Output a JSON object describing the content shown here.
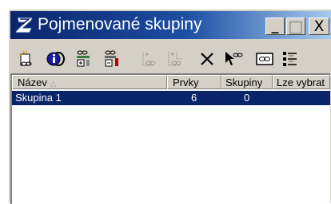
{
  "window": {
    "title": "Pojmenované skupiny",
    "controls": {
      "minimize": "_",
      "maximize": "□",
      "close": "X"
    }
  },
  "toolbar": {
    "icons": [
      "new-group-icon",
      "info-icon",
      "add-elements-icon",
      "remove-elements-icon",
      "add-to-group-icon",
      "remove-from-group-icon",
      "delete-icon",
      "select-icon",
      "group-view-icon",
      "details-list-icon"
    ]
  },
  "list": {
    "columns": [
      "Název",
      "Prvky",
      "Skupiny",
      "Lze vybrat"
    ],
    "rows": [
      {
        "name": "Skupina 1",
        "prvky": "6",
        "skupiny": "0",
        "lze_vybrat": ""
      }
    ]
  },
  "colors": {
    "titlebar_start": "#0a246a",
    "titlebar_end": "#a6caf0",
    "selection": "#0a246a",
    "face": "#d4d0c8"
  }
}
